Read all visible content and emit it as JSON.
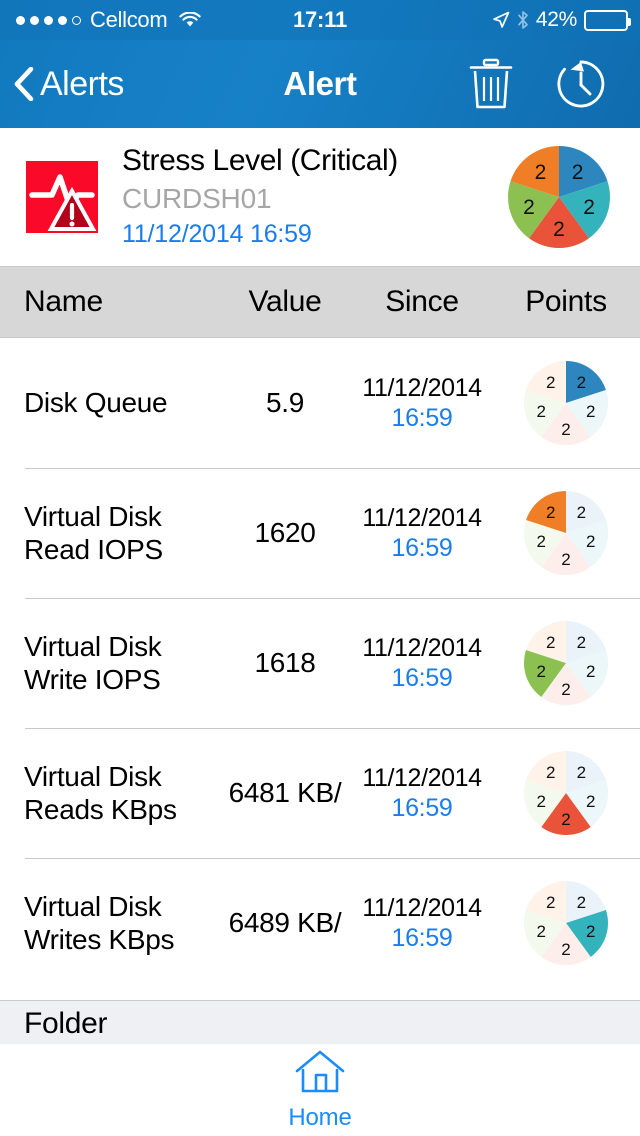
{
  "status_bar": {
    "carrier": "Cellcom",
    "signal_dots_filled": 4,
    "signal_dots_total": 5,
    "wifi_icon": "wifi-icon",
    "time": "17:11",
    "location_icon": "location-arrow-icon",
    "bluetooth_icon": "bluetooth-icon",
    "battery_percent": "42%",
    "battery_level": 42,
    "battery_icon": "battery-icon"
  },
  "nav_bar": {
    "back_label": "Alerts",
    "back_icon": "chevron-left-icon",
    "title": "Alert",
    "delete_icon": "trash-icon",
    "history_icon": "history-clock-icon"
  },
  "alert_header": {
    "icon": "critical-stress-alert-icon",
    "title": "Stress Level (Critical)",
    "host": "CURDSH01",
    "timestamp": "11/12/2014 16:59"
  },
  "table": {
    "headers": {
      "name": "Name",
      "value": "Value",
      "since": "Since",
      "points": "Points"
    },
    "rows": [
      {
        "name": "Disk Queue",
        "value": "5.9",
        "since_date": "11/12/2014",
        "since_time": "16:59",
        "highlight_index": 0
      },
      {
        "name": "Virtual Disk Read IOPS",
        "value": "1620",
        "since_date": "11/12/2014",
        "since_time": "16:59",
        "highlight_index": 4
      },
      {
        "name": "Virtual Disk Write IOPS",
        "value": "1618",
        "since_date": "11/12/2014",
        "since_time": "16:59",
        "highlight_index": 3
      },
      {
        "name": "Virtual Disk Reads KBps",
        "value": "6481 KB/",
        "since_date": "11/12/2014",
        "since_time": "16:59",
        "highlight_index": 2
      },
      {
        "name": "Virtual Disk Writes KBps",
        "value": "6489 KB/",
        "since_date": "11/12/2014",
        "since_time": "16:59",
        "highlight_index": 1
      }
    ]
  },
  "folder_section": {
    "label": "Folder"
  },
  "tab_bar": {
    "home_label": "Home",
    "home_icon": "home-icon"
  },
  "colors": {
    "nav_blue": "#1279be",
    "link_blue": "#1a7ded",
    "tab_blue": "#1a8cff",
    "alert_red": "#fa0a28",
    "header_gray": "#d7d7d7",
    "folder_gray": "#eff0f4",
    "slice_blue": "#2e86bf",
    "slice_teal": "#34b3bd",
    "slice_red": "#e8533a",
    "slice_green": "#8cc152",
    "slice_orange": "#f07e26"
  },
  "chart_data": {
    "type": "pie",
    "title": "Stress Level point distribution",
    "categories": [
      "Disk Queue",
      "Virtual Disk Writes KBps",
      "Virtual Disk Reads KBps",
      "Virtual Disk Write IOPS",
      "Virtual Disk Read IOPS"
    ],
    "values": [
      2,
      2,
      2,
      2,
      2
    ],
    "labels": [
      "2",
      "2",
      "2",
      "2",
      "2"
    ],
    "colors": [
      "#2e86bf",
      "#34b3bd",
      "#e8533a",
      "#8cc152",
      "#f07e26"
    ],
    "total": 10,
    "start_angle_deg": 0,
    "legend": "none",
    "note": "Five equal 72-degree slices starting at 12 o'clock going clockwise. Per-row charts repeat the same pie with only that row's slice at full saturation and the rest faded."
  }
}
